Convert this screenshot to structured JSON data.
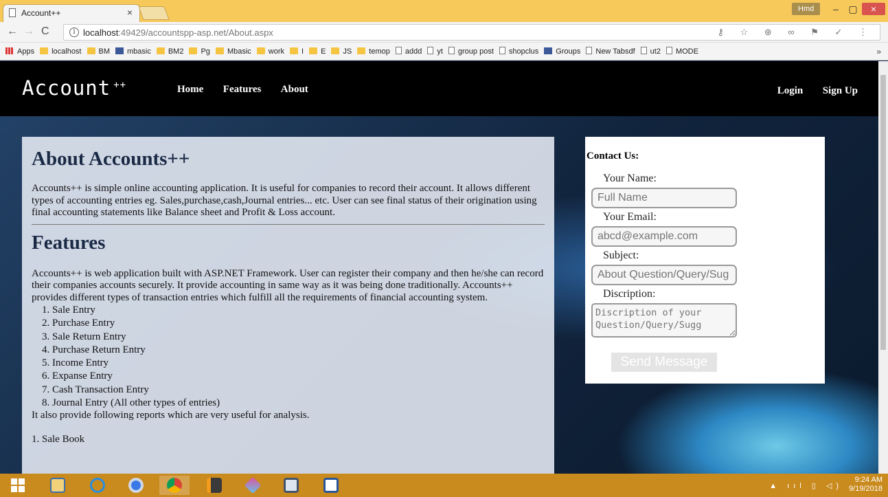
{
  "browser": {
    "tab_title": "Account++",
    "tab_close": "×",
    "user": "Hmd",
    "controls": {
      "minimize": "–",
      "maximize": "▢",
      "close": "×"
    },
    "nav": {
      "back": "←",
      "forward": "→",
      "reload": "C"
    },
    "url_host": "localhost",
    "url_path": ":49429/accountspp-asp.net/About.aspx",
    "omni_icons": "⚷ ☆ ⊛ ∞ ⚑ ✓ ⋮",
    "bookmarks": [
      {
        "label": "Apps",
        "icon": "apps-icon"
      },
      {
        "label": "localhost",
        "icon": "folder-icon"
      },
      {
        "label": "BM",
        "icon": "folder-icon"
      },
      {
        "label": "mbasic",
        "icon": "facebook-icon"
      },
      {
        "label": "BM2",
        "icon": "folder-icon"
      },
      {
        "label": "Pg",
        "icon": "folder-icon"
      },
      {
        "label": "Mbasic",
        "icon": "folder-icon"
      },
      {
        "label": "work",
        "icon": "folder-icon"
      },
      {
        "label": "I",
        "icon": "folder-icon"
      },
      {
        "label": "E",
        "icon": "folder-icon"
      },
      {
        "label": "JS",
        "icon": "folder-icon"
      },
      {
        "label": "temop",
        "icon": "folder-icon"
      },
      {
        "label": "addd",
        "icon": "page-icon"
      },
      {
        "label": "yt",
        "icon": "page-icon"
      },
      {
        "label": "group post",
        "icon": "page-icon"
      },
      {
        "label": "shopclus",
        "icon": "page-icon"
      },
      {
        "label": "Groups",
        "icon": "facebook-icon"
      },
      {
        "label": "New Tabsdf",
        "icon": "page-icon"
      },
      {
        "label": "ut2",
        "icon": "page-icon"
      },
      {
        "label": "MODE",
        "icon": "page-icon"
      }
    ],
    "bookmarks_more": "»"
  },
  "site": {
    "brand": "Account",
    "brand_sup": "++",
    "nav": [
      "Home",
      "Features",
      "About"
    ],
    "nav_right": [
      "Login",
      "Sign Up"
    ]
  },
  "about": {
    "title": "About Accounts++",
    "text": "Accounts++ is simple online accounting application. It is useful for companies to record their account. It allows different types of accounting entries eg. Sales,purchase,cash,Journal entries... etc. User can see final status of their origination using final accounting statements like Balance sheet and Profit & Loss account."
  },
  "features": {
    "title": "Features",
    "text": "Accounts++ is web application built with ASP.NET Framework. User can register their company and then he/she can record their companies accounts securely. It provide accounting in same way as it was being done traditionally. Accounts++ provides different types of transaction entries which fulfill all the requirements of financial accounting system.",
    "entries": [
      "Sale Entry",
      "Purchase Entry",
      "Sale Return Entry",
      "Purchase Return Entry",
      "Income Entry",
      "Expanse Entry",
      "Cash Transaction Entry",
      "Journal Entry (All other types of entries)"
    ],
    "reports_intro": "It also provide following reports which are very useful for analysis.",
    "first_report": "1. Sale Book"
  },
  "contact": {
    "title": "Contact Us:",
    "name_label": "Your Name:",
    "name_placeholder": "Full Name",
    "email_label": "Your Email:",
    "email_placeholder": "abcd@example.com",
    "subject_label": "Subject:",
    "subject_placeholder": "About Question/Query/Sug",
    "description_label": "Discription:",
    "description_placeholder": "Discription of your Question/Query/Sugg",
    "send_label": "Send Message"
  },
  "taskbar": {
    "time": "9:24 AM",
    "date": "9/19/2018",
    "tray": "▲ ııl ▯ ◁)"
  }
}
